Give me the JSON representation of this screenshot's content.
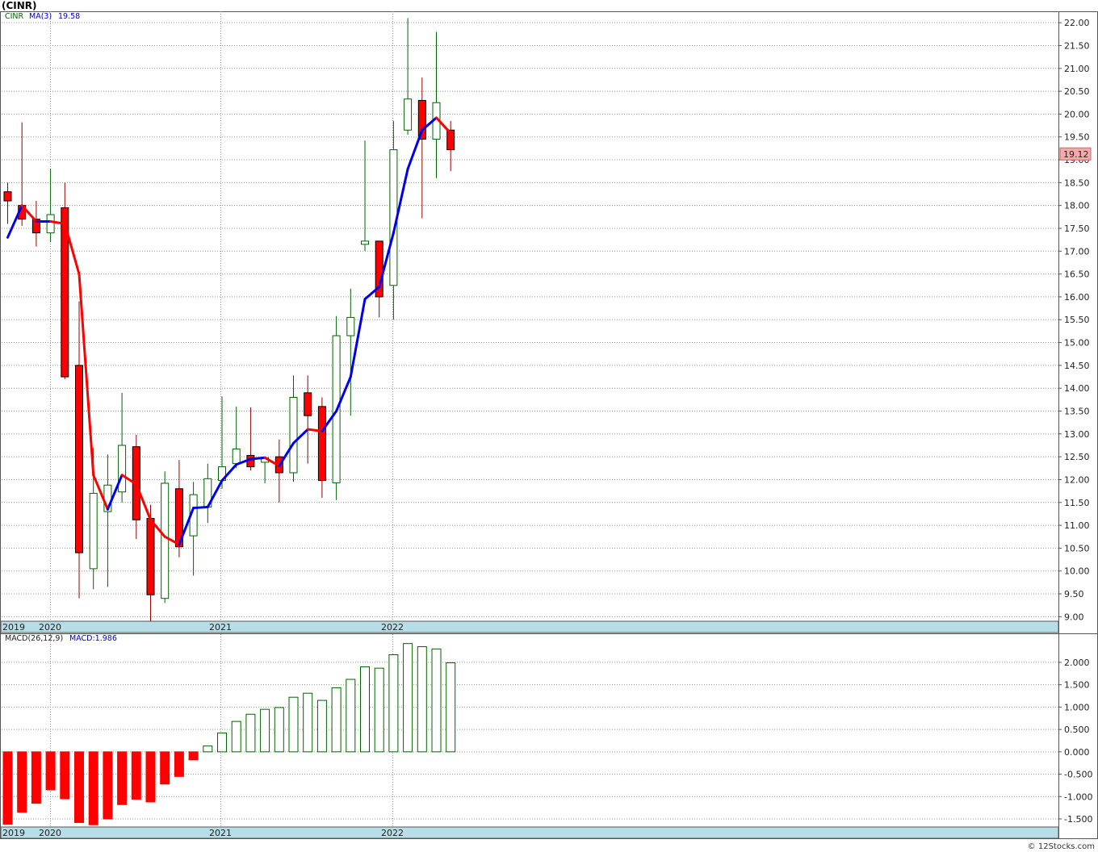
{
  "header": {
    "title": "(CINR)"
  },
  "legend": {
    "symbol": "CINR",
    "ma_label": "MA(3)",
    "ma_value": "19.58",
    "macd_label": "MACD(26,12,9)",
    "macd_value": "MACD:1.986"
  },
  "footer": {
    "credit": "© 12Stocks.com"
  },
  "colors": {
    "up": "#006400",
    "down": "#ff0000",
    "ma_up": "#0000ee",
    "ma_down": "#ff0000",
    "axis_band": "#b7dde6",
    "grid": "#999999",
    "price_tag_bg": "#f4aaaa"
  },
  "chart_data": [
    {
      "type": "candlestick",
      "title": "(CINR)",
      "timeframe": "monthly",
      "year_labels": [
        {
          "label": "2019",
          "index": -3.4
        },
        {
          "label": "2020",
          "index": 0
        },
        {
          "label": "2021",
          "index": 12
        },
        {
          "label": "2022",
          "index": 24
        }
      ],
      "ylim": [
        8.9,
        22.25
      ],
      "y_ticks": [
        "9.00",
        "9.50",
        "10.00",
        "10.50",
        "11.00",
        "11.50",
        "12.00",
        "12.50",
        "13.00",
        "13.50",
        "14.00",
        "14.50",
        "15.00",
        "15.50",
        "16.00",
        "16.50",
        "17.00",
        "17.50",
        "18.00",
        "18.50",
        "19.00",
        "19.50",
        "20.00",
        "20.50",
        "21.00",
        "21.50",
        "22.00"
      ],
      "last_price": "19.12",
      "candles": [
        {
          "o": 18.3,
          "h": 18.5,
          "l": 17.6,
          "c": 18.1
        },
        {
          "o": 18.0,
          "h": 19.82,
          "l": 17.55,
          "c": 17.7
        },
        {
          "o": 17.7,
          "h": 18.1,
          "l": 17.1,
          "c": 17.4
        },
        {
          "o": 17.4,
          "h": 18.8,
          "l": 17.2,
          "c": 17.8
        },
        {
          "o": 17.95,
          "h": 18.5,
          "l": 14.2,
          "c": 14.25
        },
        {
          "o": 14.5,
          "h": 15.9,
          "l": 9.4,
          "c": 10.4
        },
        {
          "o": 10.05,
          "h": 12.7,
          "l": 9.6,
          "c": 11.7
        },
        {
          "o": 11.3,
          "h": 12.55,
          "l": 9.65,
          "c": 11.88
        },
        {
          "o": 11.73,
          "h": 13.9,
          "l": 11.5,
          "c": 12.75
        },
        {
          "o": 12.72,
          "h": 12.98,
          "l": 10.7,
          "c": 11.12
        },
        {
          "o": 11.15,
          "h": 11.45,
          "l": 8.9,
          "c": 9.48
        },
        {
          "o": 9.4,
          "h": 12.18,
          "l": 9.3,
          "c": 11.92
        },
        {
          "o": 11.8,
          "h": 12.43,
          "l": 10.3,
          "c": 10.53
        },
        {
          "o": 10.77,
          "h": 11.95,
          "l": 9.9,
          "c": 11.67
        },
        {
          "o": 11.4,
          "h": 12.35,
          "l": 11.05,
          "c": 12.02
        },
        {
          "o": 11.98,
          "h": 13.82,
          "l": 11.8,
          "c": 12.28
        },
        {
          "o": 12.35,
          "h": 13.6,
          "l": 12.25,
          "c": 12.67
        },
        {
          "o": 12.53,
          "h": 13.58,
          "l": 12.2,
          "c": 12.28
        },
        {
          "o": 12.38,
          "h": 12.5,
          "l": 11.92,
          "c": 12.48
        },
        {
          "o": 12.5,
          "h": 12.88,
          "l": 11.5,
          "c": 12.15
        },
        {
          "o": 12.15,
          "h": 14.28,
          "l": 11.95,
          "c": 13.8
        },
        {
          "o": 13.9,
          "h": 14.28,
          "l": 12.35,
          "c": 13.4
        },
        {
          "o": 13.6,
          "h": 13.8,
          "l": 11.6,
          "c": 11.98
        },
        {
          "o": 11.93,
          "h": 15.58,
          "l": 11.55,
          "c": 15.15
        },
        {
          "o": 15.15,
          "h": 16.18,
          "l": 13.4,
          "c": 15.55
        },
        {
          "o": 17.15,
          "h": 19.42,
          "l": 17.0,
          "c": 17.22
        },
        {
          "o": 17.22,
          "h": 17.22,
          "l": 15.55,
          "c": 16.0
        },
        {
          "o": 16.25,
          "h": 19.85,
          "l": 15.5,
          "c": 19.22
        },
        {
          "o": 19.65,
          "h": 22.1,
          "l": 19.55,
          "c": 20.33
        },
        {
          "o": 20.3,
          "h": 20.8,
          "l": 17.72,
          "c": 19.45
        },
        {
          "o": 19.45,
          "h": 21.8,
          "l": 18.6,
          "c": 20.25
        },
        {
          "o": 19.65,
          "h": 19.85,
          "l": 18.75,
          "c": 19.22
        }
      ],
      "ma3": [
        17.3,
        18.0,
        17.65,
        17.65,
        17.6,
        16.5,
        12.1,
        11.35,
        12.1,
        11.9,
        11.12,
        10.75,
        10.58,
        11.38,
        11.4,
        11.98,
        12.33,
        12.45,
        12.48,
        12.3,
        12.8,
        13.1,
        13.06,
        13.5,
        14.25,
        15.95,
        16.22,
        17.4,
        18.8,
        19.65,
        19.92,
        19.58
      ]
    },
    {
      "type": "bar",
      "title": "MACD(26,12,9)",
      "ylim": [
        -1.68,
        2.63
      ],
      "y_ticks": [
        "-1.500",
        "-1.000",
        "-0.500",
        "0.000",
        "0.500",
        "1.000",
        "1.500",
        "2.000"
      ],
      "values": [
        -1.62,
        -1.35,
        -1.15,
        -0.85,
        -1.05,
        -1.58,
        -1.63,
        -1.5,
        -1.18,
        -1.06,
        -1.12,
        -0.72,
        -0.55,
        -0.18,
        0.13,
        0.42,
        0.68,
        0.84,
        0.95,
        0.99,
        1.22,
        1.31,
        1.15,
        1.43,
        1.62,
        1.9,
        1.87,
        2.17,
        2.42,
        2.35,
        2.3,
        1.99
      ]
    }
  ]
}
